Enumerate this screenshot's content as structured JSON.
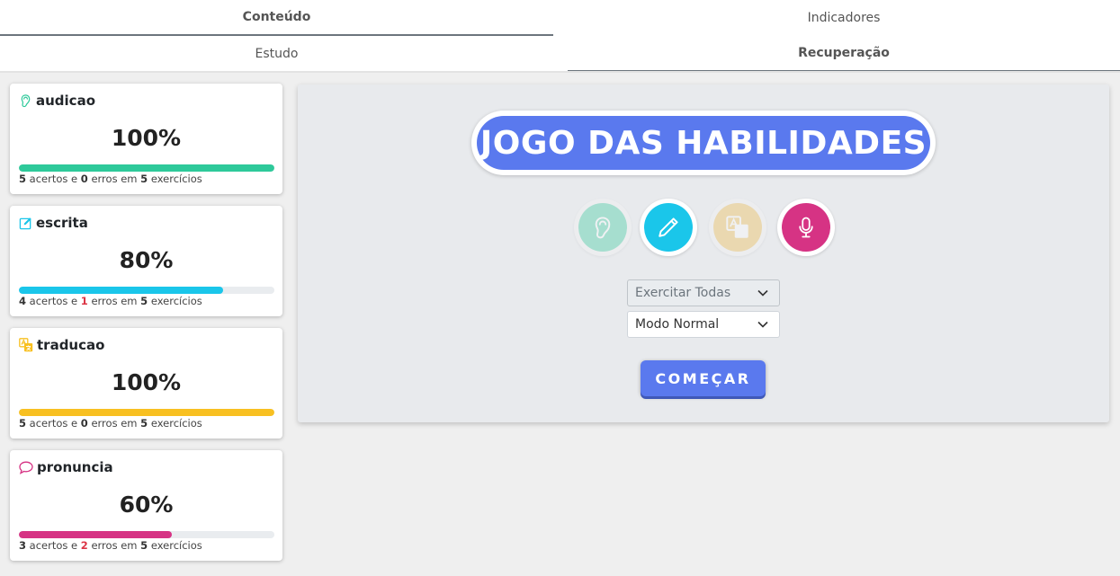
{
  "tabs": {
    "conteudo": "Conteúdo",
    "indicadores": "Indicadores",
    "estudo": "Estudo",
    "recuperacao": "Recuperação"
  },
  "skills": [
    {
      "name": "audicao",
      "percent_label": "100%",
      "progress": 100,
      "acertos": "5",
      "erros": "0",
      "exercicios": "5",
      "color": "#2ec99a",
      "icon": "ear-icon"
    },
    {
      "name": "escrita",
      "percent_label": "80%",
      "progress": 80,
      "acertos": "4",
      "erros": "1",
      "exercicios": "5",
      "color": "#1ac6ea",
      "icon": "pencil-square-icon"
    },
    {
      "name": "traducao",
      "percent_label": "100%",
      "progress": 100,
      "acertos": "5",
      "erros": "0",
      "exercicios": "5",
      "color": "#f8c021",
      "icon": "translate-icon"
    },
    {
      "name": "pronuncia",
      "percent_label": "60%",
      "progress": 60,
      "acertos": "3",
      "erros": "2",
      "exercicios": "5",
      "color": "#d63384",
      "icon": "speech-bubble-icon"
    }
  ],
  "stats_text": {
    "acertos": "acertos e",
    "erros": "erros em",
    "exercicios": "exercícios"
  },
  "game": {
    "title": "JOGO DAS HABILIDADES",
    "select_skill": "Exercitar Todas",
    "select_mode": "Modo Normal",
    "start_label": "COMEÇAR",
    "buttons": [
      {
        "icon": "ear-icon",
        "color": "#2ec99a",
        "active": false
      },
      {
        "icon": "pencil-icon",
        "color": "#1ac6ea",
        "active": true
      },
      {
        "icon": "translate-icon",
        "color": "#f0b840",
        "active": false
      },
      {
        "icon": "microphone-icon",
        "color": "#d63384",
        "active": true
      }
    ]
  }
}
